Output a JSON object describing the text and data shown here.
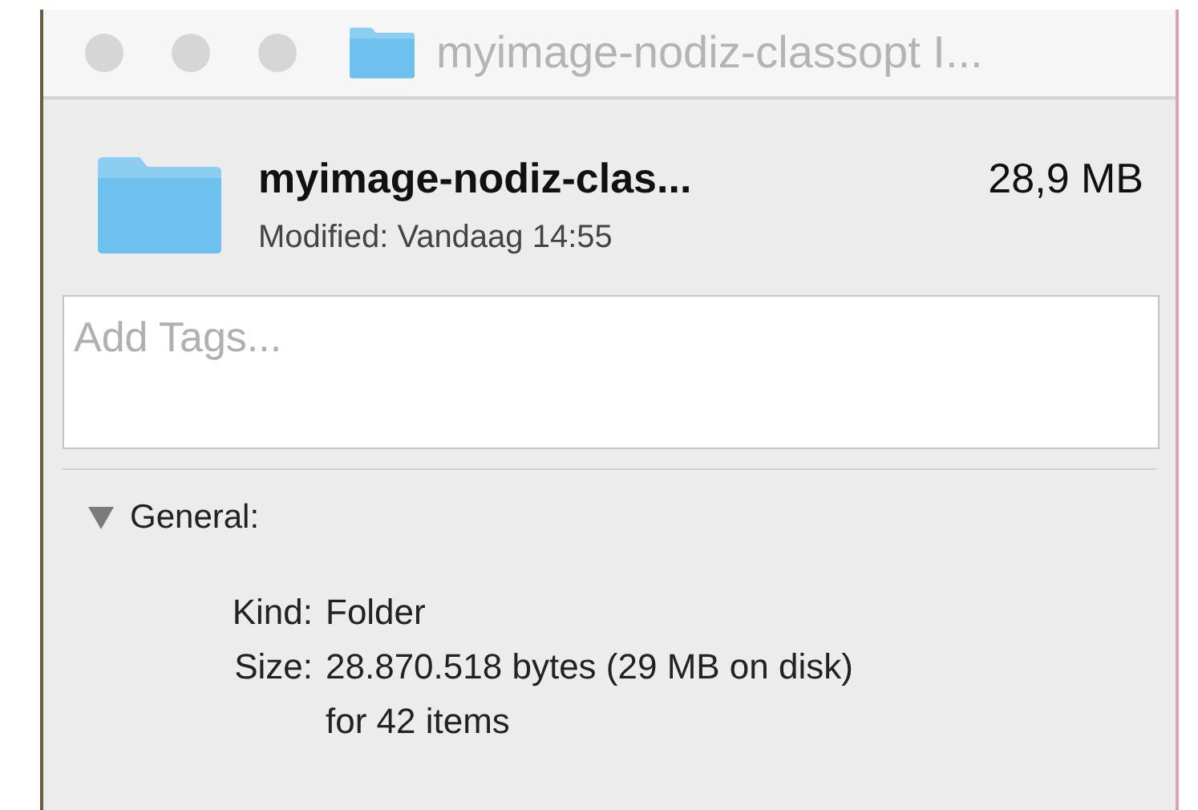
{
  "window": {
    "title": "myimage-nodiz-classopt I...",
    "buttons": [
      {
        "disabled": true
      },
      {
        "disabled": true
      },
      {
        "disabled": true
      }
    ]
  },
  "header": {
    "name": "myimage-nodiz-clas...",
    "size": "28,9 MB",
    "modified": "Modified: Vandaag 14:55"
  },
  "tags": {
    "placeholder": "Add Tags..."
  },
  "general": {
    "title": "General:",
    "expanded": true,
    "rows": [
      {
        "label": "Kind:",
        "value": "Folder"
      },
      {
        "label": "Size:",
        "value": "28.870.518 bytes (29 MB on disk)"
      },
      {
        "label": "",
        "value": "for 42 items"
      }
    ]
  }
}
